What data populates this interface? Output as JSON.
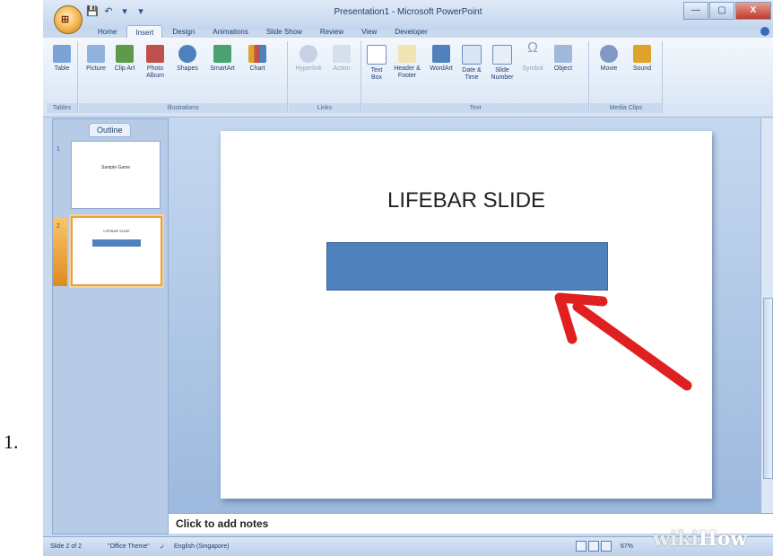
{
  "step_number": "1.",
  "window": {
    "title": "Presentation1 - Microsoft PowerPoint",
    "qat": [
      "💾",
      "↶",
      "▾",
      "▾"
    ],
    "controls": {
      "minimize": "—",
      "maximize": "▢",
      "close": "X"
    },
    "office_button": "⊞"
  },
  "tabs": [
    "Home",
    "Insert",
    "Design",
    "Animations",
    "Slide Show",
    "Review",
    "View",
    "Developer"
  ],
  "active_tab": "Insert",
  "ribbon": {
    "groups": {
      "tables": "Tables",
      "illustrations": "Illustrations",
      "links": "Links",
      "text": "Text",
      "media": "Media Clips"
    },
    "buttons": {
      "table": "Table",
      "picture": "Picture",
      "clipart": "Clip Art",
      "photoalbum": "Photo Album",
      "shapes": "Shapes",
      "smartart": "SmartArt",
      "chart": "Chart",
      "hyperlink": "Hyperlink",
      "action": "Action",
      "textbox": "Text Box",
      "headerfooter": "Header & Footer",
      "wordart": "WordArt",
      "datetime": "Date & Time",
      "slidenumber": "Slide Number",
      "symbol": "Symbol",
      "object": "Object",
      "movie": "Movie",
      "sound": "Sound"
    }
  },
  "left_pane": {
    "tab": "Outline",
    "slides": [
      {
        "num": "1",
        "title": "Sample Game"
      },
      {
        "num": "2",
        "title": "LIFEBAR SLIDE"
      }
    ]
  },
  "slide": {
    "title": "LIFEBAR SLIDE"
  },
  "notes_placeholder": "Click to add notes",
  "status": {
    "slide": "Slide 2 of 2",
    "theme": "\"Office Theme\"",
    "language": "English (Singapore)",
    "zoom": "67%"
  },
  "watermark": {
    "prefix": "wiki",
    "suffix": "How"
  },
  "colors": {
    "lifebar": "#4f81bd",
    "arrow": "#e02020"
  }
}
